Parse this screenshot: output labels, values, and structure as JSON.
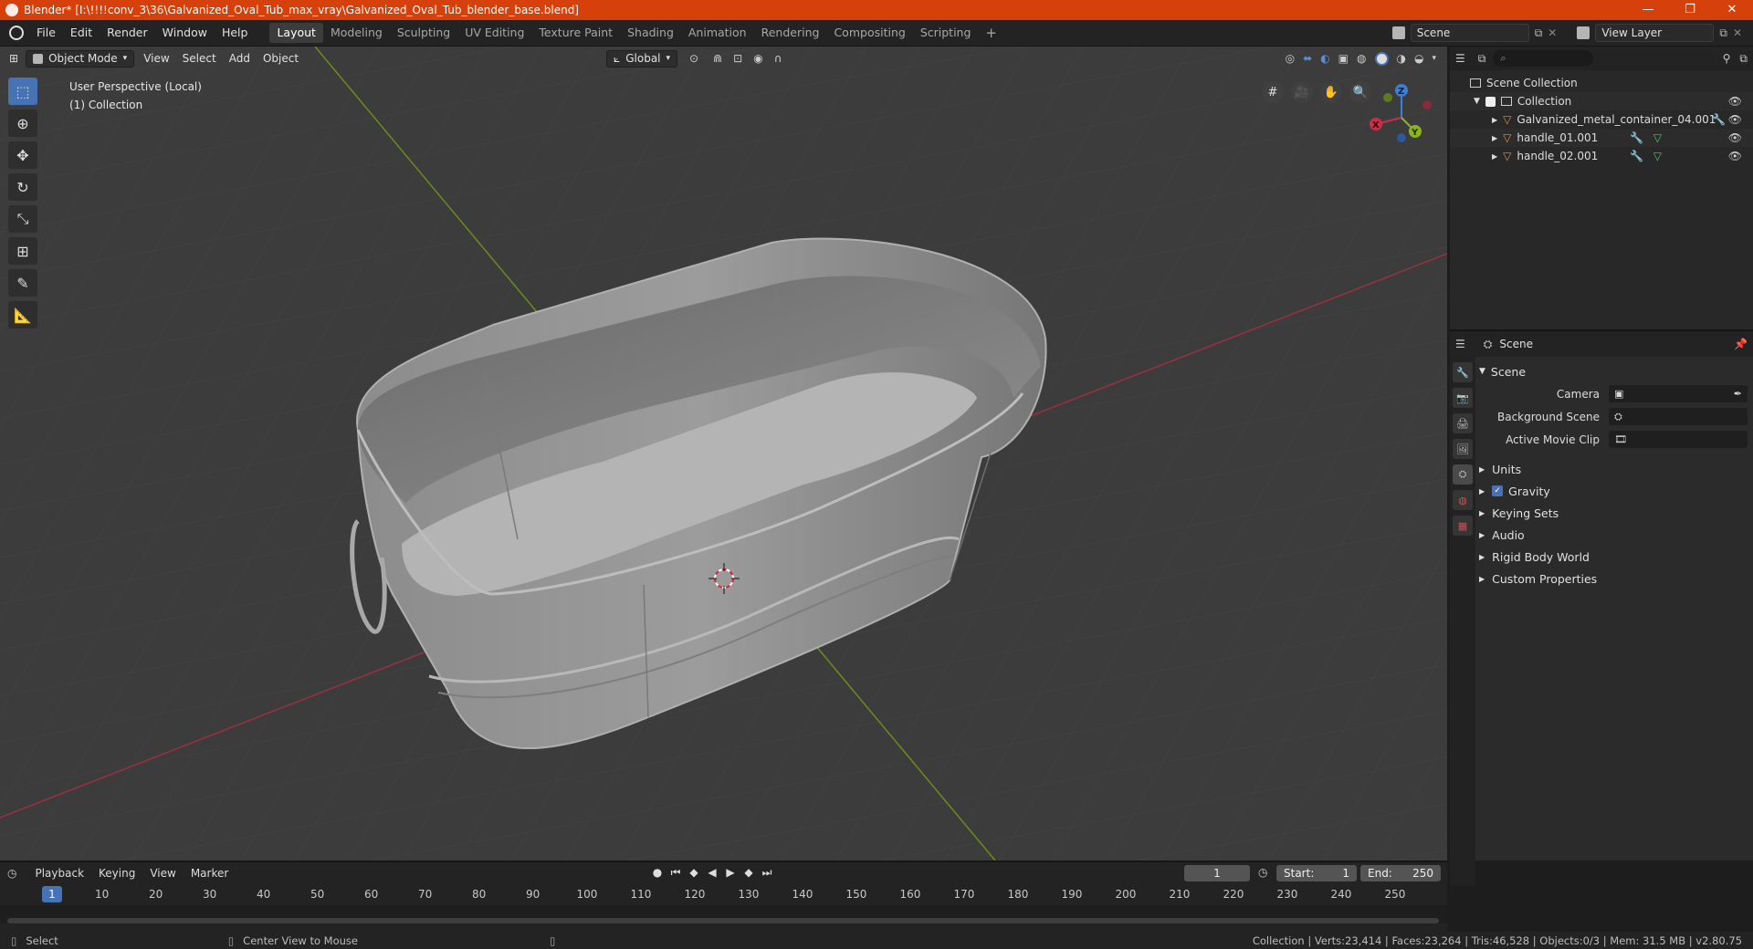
{
  "window": {
    "title": "Blender* [I:\\!!!!conv_3\\36\\Galvanized_Oval_Tub_max_vray\\Galvanized_Oval_Tub_blender_base.blend]"
  },
  "menu": [
    "File",
    "Edit",
    "Render",
    "Window",
    "Help"
  ],
  "workspaces": [
    "Layout",
    "Modeling",
    "Sculpting",
    "UV Editing",
    "Texture Paint",
    "Shading",
    "Animation",
    "Rendering",
    "Compositing",
    "Scripting"
  ],
  "active_workspace": "Layout",
  "scene_field": "Scene",
  "view_layer_field": "View Layer",
  "viewport": {
    "mode": "Object Mode",
    "menus": [
      "View",
      "Select",
      "Add",
      "Object"
    ],
    "orientation": "Global",
    "info_line1": "User Perspective (Local)",
    "info_line2": "(1) Collection",
    "gizmo": {
      "x": "X",
      "y": "Y",
      "z": "Z"
    },
    "colors": {
      "bg": "#3c3c3c",
      "x_axis": "#c8304a",
      "y_axis": "#8cb320",
      "select": "#4772b3"
    }
  },
  "outliner": {
    "root": "Scene Collection",
    "collection": "Collection",
    "objects": [
      "Galvanized_metal_container_04.001",
      "handle_01.001",
      "handle_02.001"
    ]
  },
  "properties": {
    "header": "Scene",
    "section": "Scene",
    "fields": [
      {
        "label": "Camera"
      },
      {
        "label": "Background Scene"
      },
      {
        "label": "Active Movie Clip"
      }
    ],
    "panels": [
      "Units",
      "Gravity",
      "Keying Sets",
      "Audio",
      "Rigid Body World",
      "Custom Properties"
    ],
    "gravity_checked": true
  },
  "timeline": {
    "menus": [
      "Playback",
      "Keying",
      "View",
      "Marker"
    ],
    "current_frame": "1",
    "start_label": "Start:",
    "start": "1",
    "end_label": "End:",
    "end": "250",
    "ticks": [
      "10",
      "20",
      "30",
      "40",
      "50",
      "60",
      "70",
      "80",
      "90",
      "100",
      "110",
      "120",
      "130",
      "140",
      "150",
      "160",
      "170",
      "180",
      "190",
      "200",
      "210",
      "220",
      "230",
      "240",
      "250"
    ],
    "cursor_frame": "1"
  },
  "status": {
    "left": "Select",
    "middle": "Center View to Mouse",
    "right": "Collection | Verts:23,414 | Faces:23,264 | Tris:46,528 | Objects:0/3 | Mem: 31.5 MB | v2.80.75"
  }
}
